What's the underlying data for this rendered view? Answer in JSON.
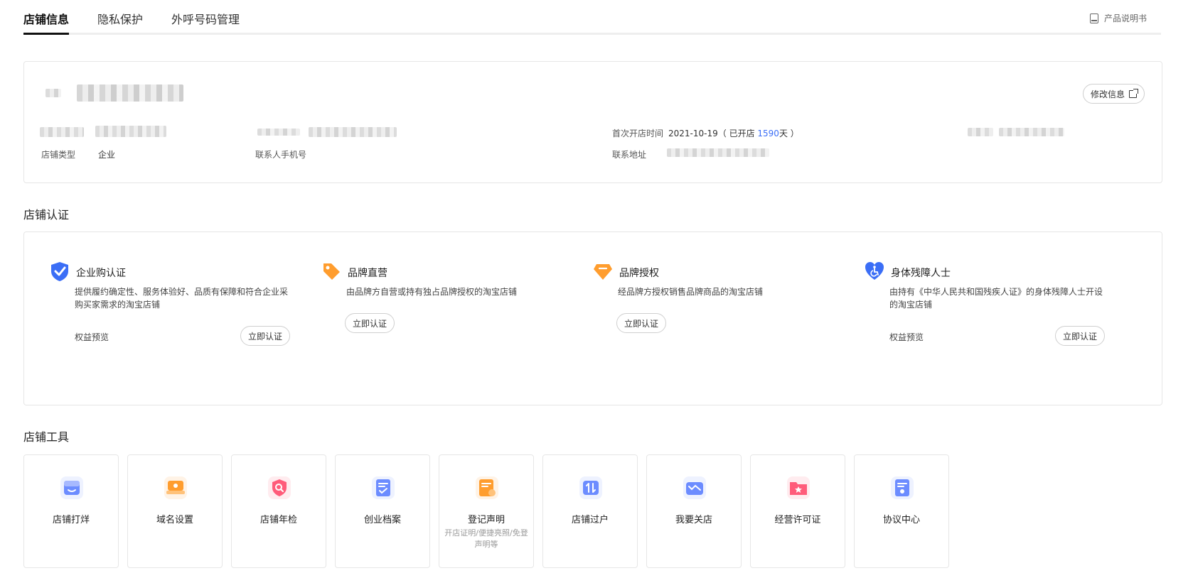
{
  "tabs": [
    {
      "label": "店铺信息",
      "active": true
    },
    {
      "label": "隐私保护",
      "active": false
    },
    {
      "label": "外呼号码管理",
      "active": false
    }
  ],
  "manual_label": "产品说明书",
  "info": {
    "edit_label": "修改信息",
    "shop_type_label": "店铺类型",
    "shop_type_value": "企业",
    "contact_phone_label": "联系人手机号",
    "open_time_label": "首次开店时间",
    "open_date": "2021-10-19",
    "open_prefix": "（ 已开店 ",
    "open_days": "1590",
    "open_suffix": "天 ）",
    "address_label": "联系地址"
  },
  "cert": {
    "title": "店铺认证",
    "items": [
      {
        "name": "企业购认证",
        "desc": "提供履约确定性、服务体验好、品质有保障和符合企业采购买家需求的淘宝店铺",
        "preview": "权益预览",
        "button": "立即认证",
        "icon": "shield-check-icon"
      },
      {
        "name": "品牌直营",
        "desc": "由品牌方自营或持有独占品牌授权的淘宝店铺",
        "preview": "",
        "button": "立即认证",
        "icon": "tag-icon"
      },
      {
        "name": "品牌授权",
        "desc": "经品牌方授权销售品牌商品的淘宝店铺",
        "preview": "",
        "button": "立即认证",
        "icon": "diamond-icon"
      },
      {
        "name": "身体残障人士",
        "desc": "由持有《中华人民共和国残疾人证》的身体残障人士开设的淘宝店铺",
        "preview": "权益预览",
        "button": "立即认证",
        "icon": "heart-wheelchair-icon"
      }
    ]
  },
  "tools": {
    "title": "店铺工具",
    "items": [
      {
        "name": "店铺打烊",
        "sub": "",
        "icon": "shop-close-icon"
      },
      {
        "name": "域名设置",
        "sub": "",
        "icon": "domain-icon"
      },
      {
        "name": "店铺年检",
        "sub": "",
        "icon": "inspection-icon"
      },
      {
        "name": "创业档案",
        "sub": "",
        "icon": "archive-icon"
      },
      {
        "name": "登记声明",
        "sub": "开店证明/便捷亮照/免登声明等",
        "icon": "register-icon"
      },
      {
        "name": "店铺过户",
        "sub": "",
        "icon": "transfer-icon"
      },
      {
        "name": "我要关店",
        "sub": "",
        "icon": "close-shop-icon"
      },
      {
        "name": "经营许可证",
        "sub": "",
        "icon": "license-icon"
      },
      {
        "name": "协议中心",
        "sub": "",
        "icon": "agreement-icon"
      }
    ]
  },
  "colors": {
    "accent": "#3b6ef6",
    "tab_active": "#111111",
    "border": "#e6e6e6"
  }
}
